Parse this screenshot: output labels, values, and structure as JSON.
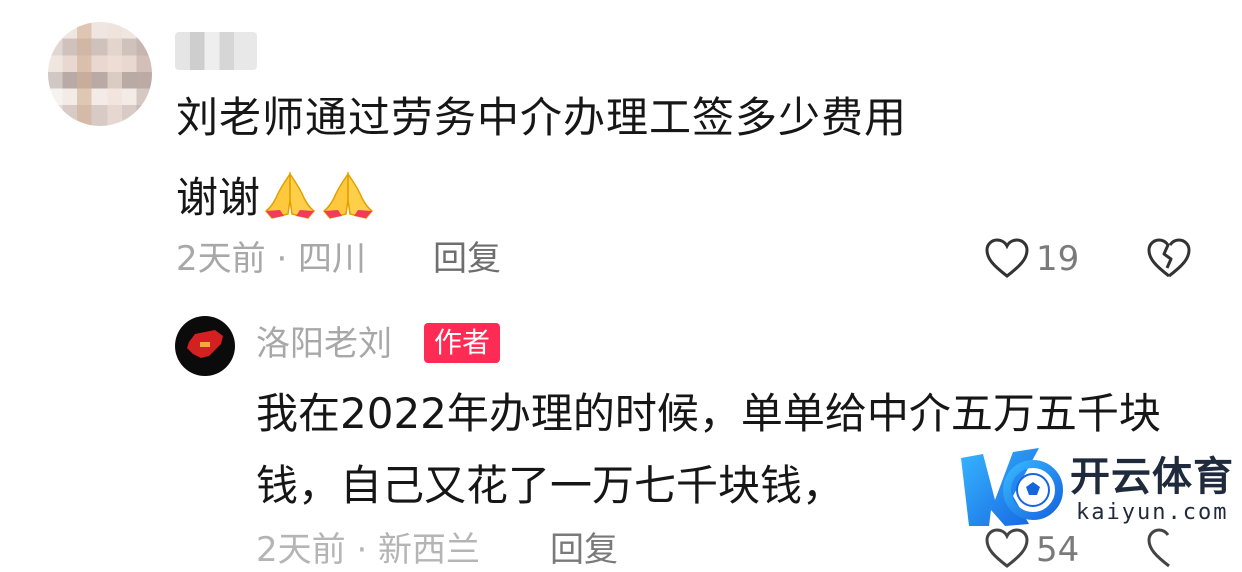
{
  "comment": {
    "text_line1": "刘老师通过劳务中介办理工签多少费用",
    "text_line2": "谢谢",
    "emoji": "folded-hands-emoji",
    "meta": "2天前 · 四川",
    "reply_label": "回复",
    "like_count": "19"
  },
  "reply": {
    "author": "洛阳老刘",
    "badge": "作者",
    "text_line1": "我在2022年办理的时候，单单给中介五万五千块",
    "text_line2": "钱，自己又花了一万七千块钱，",
    "meta": "2天前 · 新西兰",
    "reply_label": "回复",
    "like_count": "54"
  },
  "watermark": {
    "name": "开云体育",
    "domain": "kaiyun.com"
  },
  "colors": {
    "badge": "#fe2c55",
    "meta": "#a8a8a8"
  }
}
